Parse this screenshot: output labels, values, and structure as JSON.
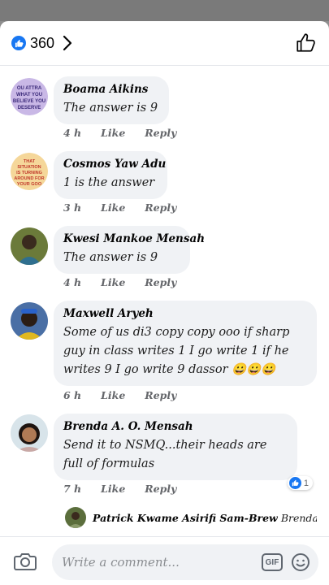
{
  "header": {
    "like_count": "360",
    "icons": [
      "like-badge-icon",
      "chevron-right-icon",
      "thumbs-up-outline-icon"
    ],
    "accent_color": "#1877f2"
  },
  "comments": [
    {
      "author": "Boama Aikins",
      "text": "The answer is 9",
      "time": "4 h",
      "like_label": "Like",
      "reply_label": "Reply",
      "avatar_text": "OU ATTRA WHAT YOU BELIEVE YOU DESERVE"
    },
    {
      "author": "Cosmos Yaw Adu",
      "text": "1 is the answer",
      "time": "3 h",
      "like_label": "Like",
      "reply_label": "Reply",
      "avatar_text": "THAT SITUATION IS TURNING AROUND FOR YOUR GOO"
    },
    {
      "author": "Kwesi Mankoe Mensah",
      "text": "The answer is 9",
      "time": "4 h",
      "like_label": "Like",
      "reply_label": "Reply"
    },
    {
      "author": "Maxwell Aryeh",
      "text": "Some of us di3 copy copy ooo if sharp guy in class writes 1 I go write 1 if he writes 9 I go write 9 dassor",
      "emojis": "😀😀😀",
      "time": "6 h",
      "like_label": "Like",
      "reply_label": "Reply"
    },
    {
      "author": "Brenda A. O. Mensah",
      "text": "Send it to NSMQ...their heads are full of formulas",
      "time": "7 h",
      "like_label": "Like",
      "reply_label": "Reply",
      "reaction_count": "1"
    }
  ],
  "reply_preview": {
    "author": "Patrick Kwame Asirifi Sam-Brew",
    "text": "Brenda A...."
  },
  "composer": {
    "placeholder": "Write a comment...",
    "gif_label": "GIF",
    "icons": [
      "camera-icon",
      "gif-icon",
      "emoji-icon"
    ]
  }
}
